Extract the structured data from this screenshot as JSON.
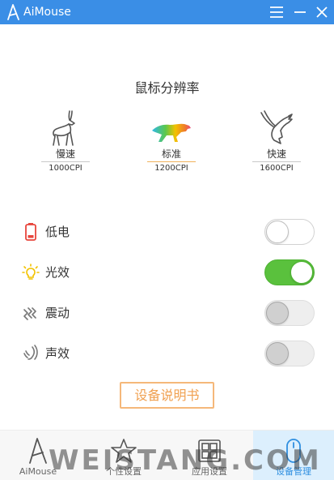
{
  "titlebar": {
    "title": "AiMouse",
    "bg_color": "#3a8ee6",
    "menu_icon": "hamburger-menu-icon",
    "minimize_icon": "minimize-icon",
    "close_icon": "close-icon"
  },
  "resolution": {
    "title": "鼠标分辨率",
    "options": [
      {
        "label": "慢速",
        "dpi": "1000CPI",
        "icon": "gazelle-icon",
        "active": false
      },
      {
        "label": "标准",
        "dpi": "1200CPI",
        "icon": "cheetah-icon",
        "active": true
      },
      {
        "label": "快速",
        "dpi": "1600CPI",
        "icon": "eagle-icon",
        "active": false
      }
    ]
  },
  "settings": [
    {
      "label": "低电",
      "icon": "battery-icon",
      "state": "off"
    },
    {
      "label": "光效",
      "icon": "lightbulb-icon",
      "state": "on"
    },
    {
      "label": "震动",
      "icon": "vibration-icon",
      "state": "disabled"
    },
    {
      "label": "声效",
      "icon": "sound-icon",
      "state": "disabled"
    }
  ],
  "manual_button": "设备说明书",
  "bottom_nav": [
    {
      "label": "AiMouse",
      "icon": "aimouse-logo-icon",
      "active": false
    },
    {
      "label": "个性设置",
      "icon": "star-icon",
      "active": false
    },
    {
      "label": "应用设置",
      "icon": "grid-icon",
      "active": false
    },
    {
      "label": "设备管理",
      "icon": "mouse-icon",
      "active": true
    }
  ],
  "watermark": "WEISTANG.COM",
  "colors": {
    "accent_blue": "#3a8ee6",
    "toggle_on": "#5ac13d",
    "battery_red": "#e8453c",
    "bulb_yellow": "#f2c200",
    "manual_orange": "#f0a050",
    "nav_active_bg": "#dceffd"
  }
}
